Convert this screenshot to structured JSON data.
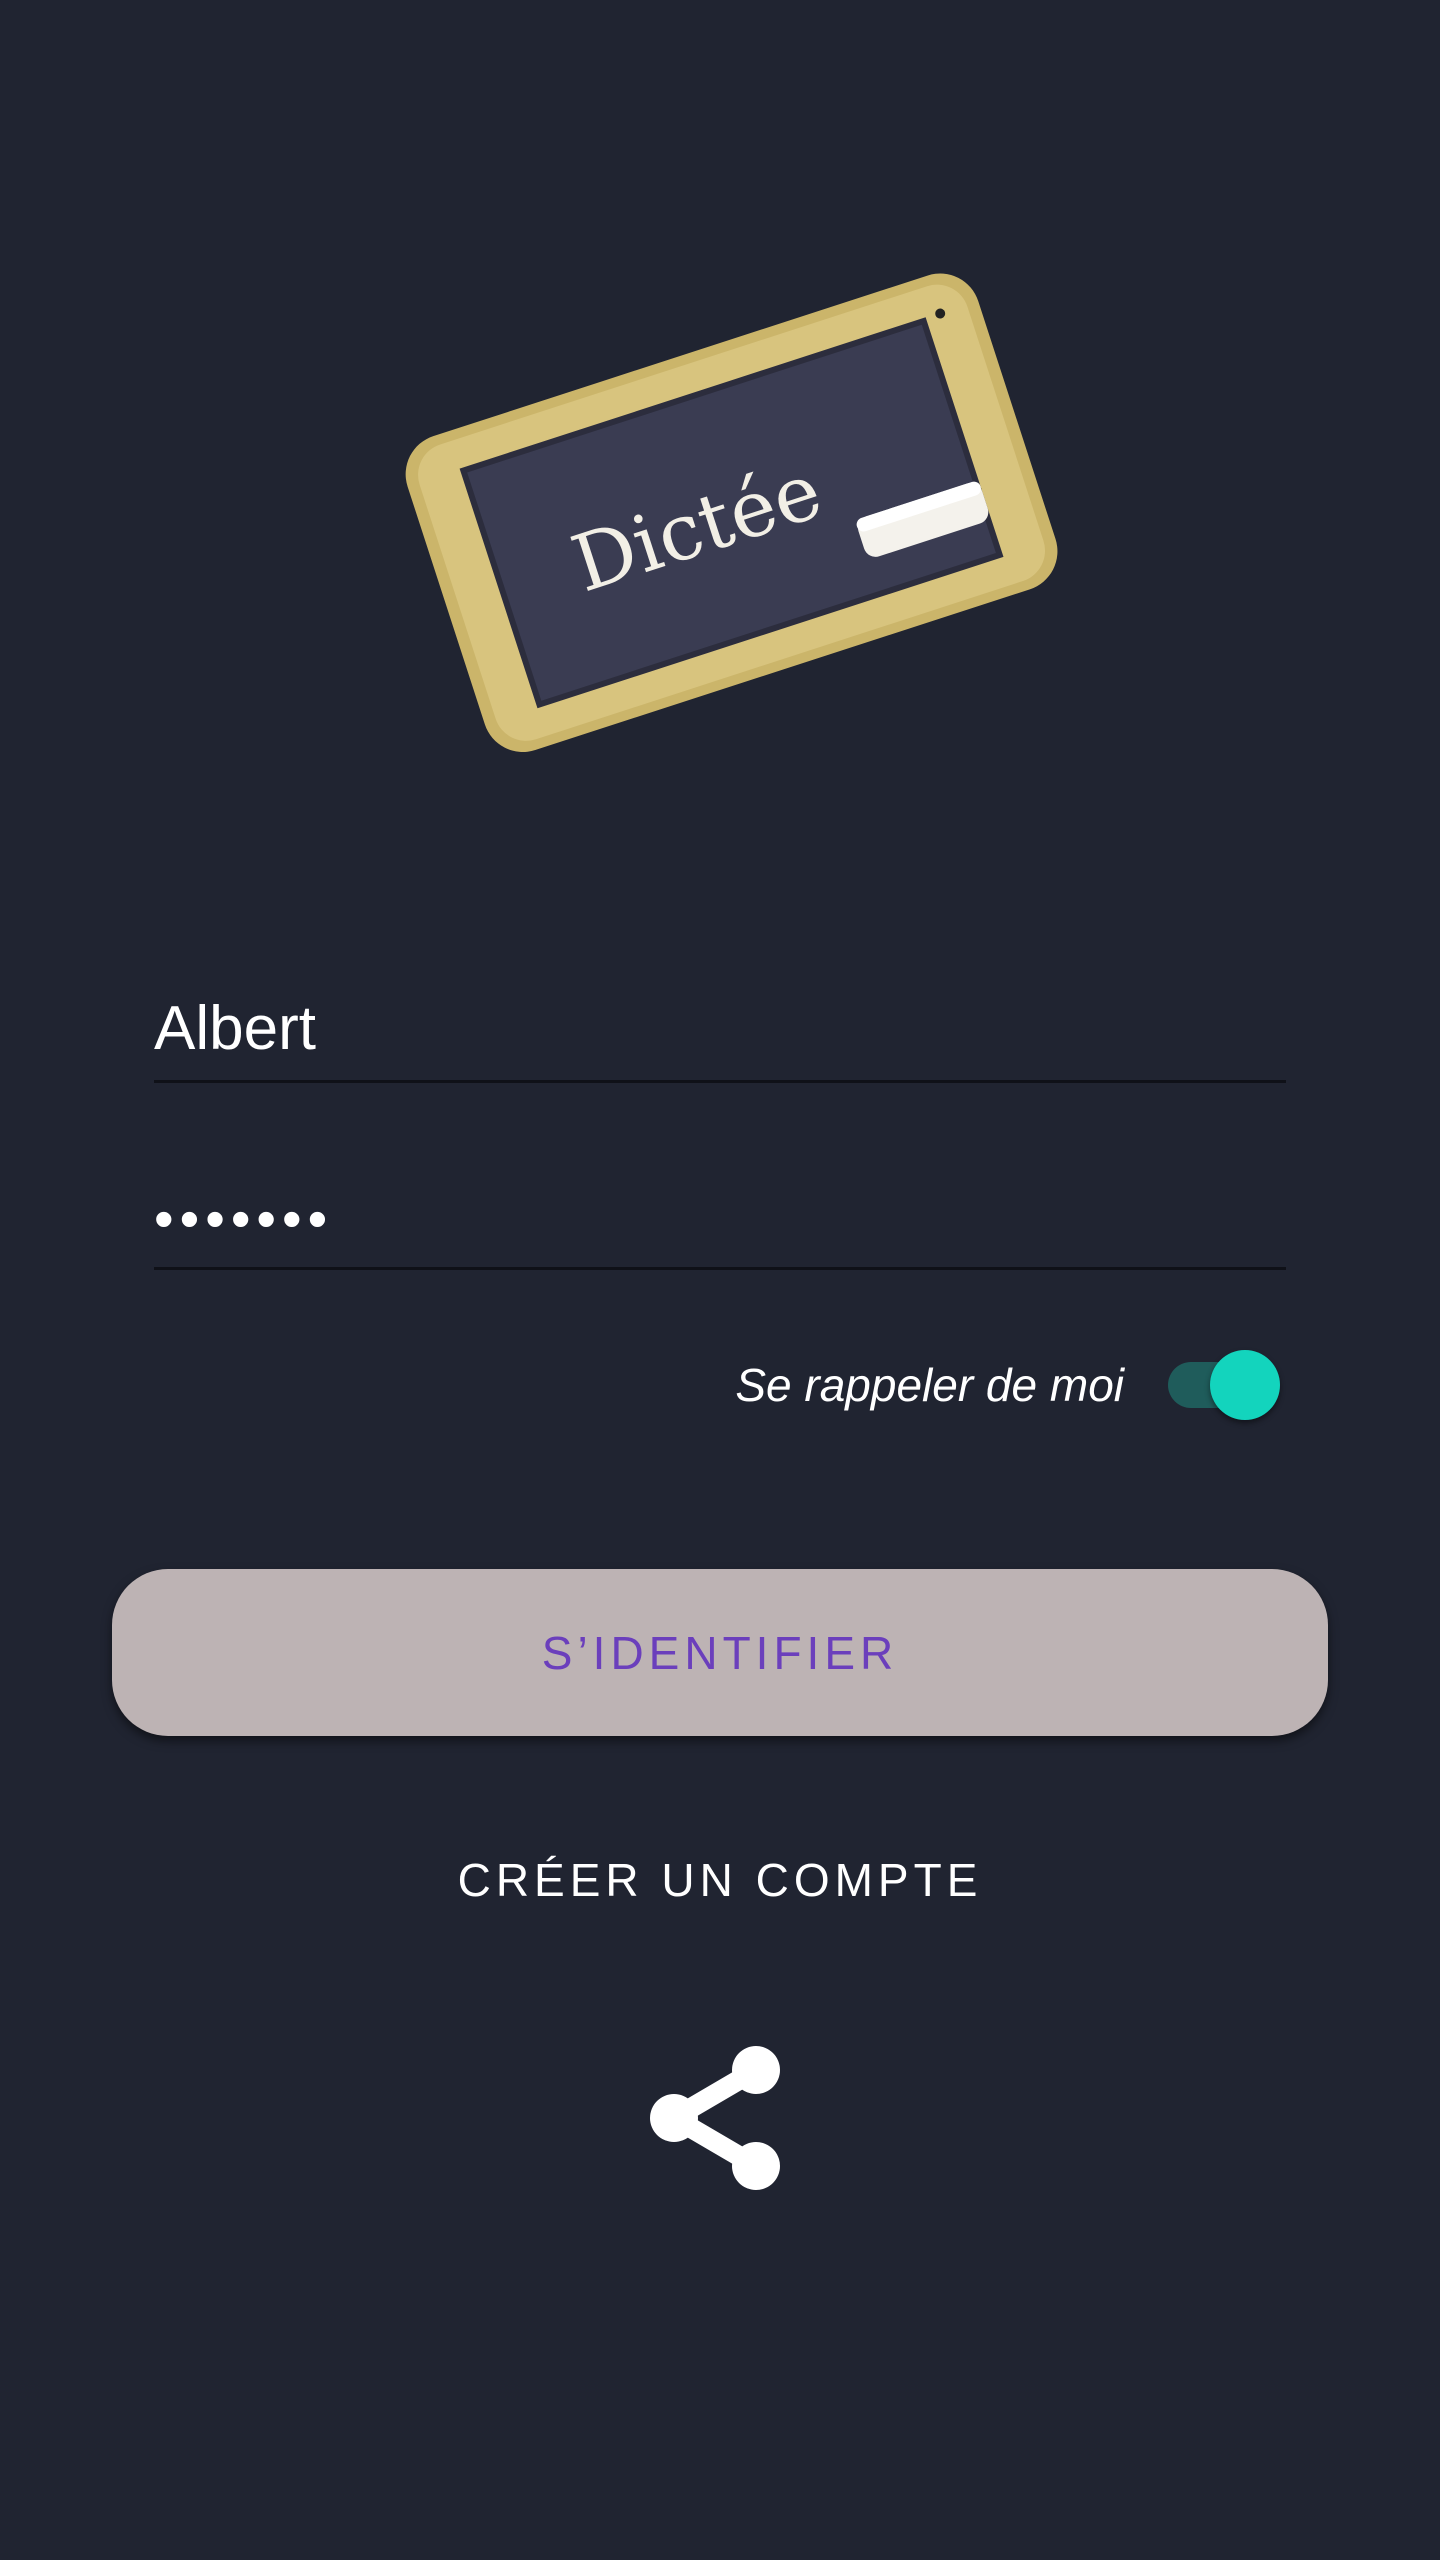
{
  "logo": {
    "slate_text": "Dictée",
    "alt": "Dictée"
  },
  "form": {
    "username_value": "Albert",
    "password_value": "•••••••",
    "remember_label": "Se rappeler de moi",
    "remember_checked": true
  },
  "actions": {
    "login_label": "S’IDENTIFIER",
    "create_account_label": "CRÉER UN COMPTE",
    "share_icon": "share-icon"
  },
  "colors": {
    "background": "#202431",
    "accent": "#13d4bd",
    "button_bg": "#bdb3b4",
    "button_text": "#6b3fbc"
  }
}
